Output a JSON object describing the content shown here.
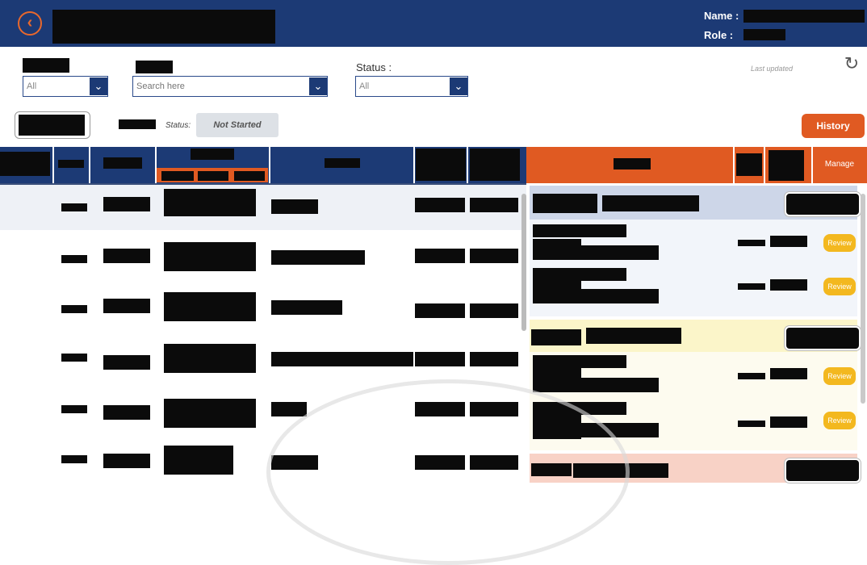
{
  "header": {
    "name_label": "Name :",
    "role_label": "Role :"
  },
  "filters": {
    "status_label": "Status :",
    "first": {
      "value": "All"
    },
    "search": {
      "placeholder": "Search here"
    },
    "status": {
      "value": "All"
    },
    "last_updated": "Last updated"
  },
  "status_bar": {
    "status_label": "Status:",
    "status_value": "Not Started",
    "history_label": "History"
  },
  "table": {
    "manage_label": "Manage",
    "review_label": "Review"
  },
  "icons": {
    "back": "back-arrow-icon",
    "chevron": "chevron-down-icon",
    "refresh": "refresh-icon"
  },
  "colors": {
    "primary": "#1c3a75",
    "accent": "#e05a22",
    "review": "#f3b81f"
  }
}
